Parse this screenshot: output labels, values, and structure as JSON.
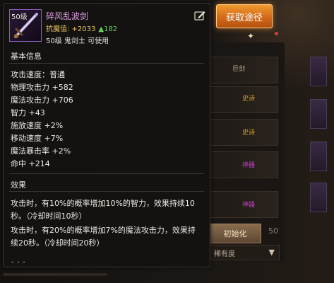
{
  "item": {
    "level_badge": "50级",
    "name": "碎风乱波剑",
    "resist_label": "抗魔值: +2033",
    "resist_increase": "▲182",
    "class_line": "50级 鬼剑士 可使用"
  },
  "sections": {
    "basic_title": "基本信息",
    "effect_title": "效果"
  },
  "stats": [
    "攻击速度：普通",
    "物理攻击力 +582",
    "魔法攻击力 +706",
    "智力 +43",
    "施放速度 +2%",
    "移动速度 +7%",
    "魔法暴击率 +2%",
    "命中 +214"
  ],
  "effects": [
    "攻击时，有10%的概率增加10%的智力，效果持续10",
    "秒。（冷却时间10秒）",
    "攻击时，有20%的概率增加7%的魔法攻击力，效果持",
    "续20秒。（冷却时间20秒）"
  ],
  "buttons": {
    "obtain": "获取途径"
  },
  "background": {
    "tags": [
      "巨剑",
      "史诗",
      "史诗",
      "神器",
      "神器"
    ],
    "init_button": "初始化",
    "dropdown_label": "稀有度",
    "side_number": "50"
  },
  "colors": {
    "item_name": "#e29fe8",
    "resist": "#e8c25a",
    "resist_up": "#62d15f",
    "obtain_button": "#d2691a",
    "epic_tag": "#d8a020",
    "artifact_tag": "#c040c0"
  },
  "icons": {
    "item": "sword-icon",
    "edit": "edit-icon",
    "sparkle": "sparkle-icon"
  }
}
